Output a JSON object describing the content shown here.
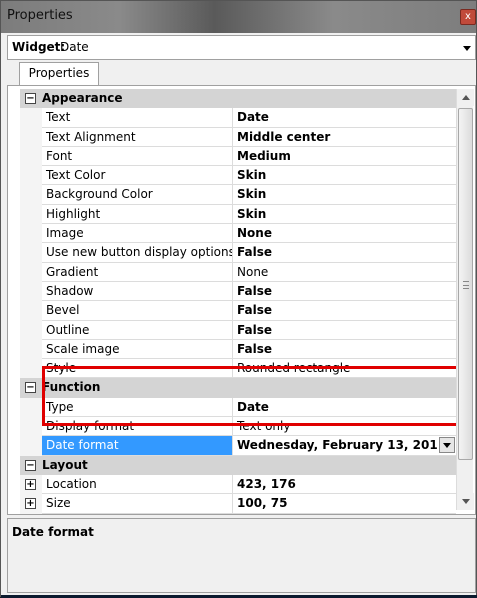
{
  "window": {
    "title": "Properties",
    "close_glyph": "x"
  },
  "widget": {
    "label": "Widget:",
    "value": "Date"
  },
  "tabs": [
    {
      "label": "Properties"
    }
  ],
  "categories": [
    {
      "label": "Appearance",
      "expander": "−",
      "rows": [
        {
          "name": "Text",
          "value": "Date",
          "bold": true
        },
        {
          "name": "Text Alignment",
          "value": "Middle center",
          "bold": true
        },
        {
          "name": "Font",
          "value": "Medium",
          "bold": true
        },
        {
          "name": "Text Color",
          "value": "Skin",
          "bold": true
        },
        {
          "name": "Background Color",
          "value": "Skin",
          "bold": true
        },
        {
          "name": "Highlight",
          "value": "Skin",
          "bold": true
        },
        {
          "name": "Image",
          "value": "None",
          "bold": true
        },
        {
          "name": "Use new button display options",
          "value": "False",
          "bold": true
        },
        {
          "name": "Gradient",
          "value": "None",
          "bold": false
        },
        {
          "name": "Shadow",
          "value": "False",
          "bold": true
        },
        {
          "name": "Bevel",
          "value": "False",
          "bold": true
        },
        {
          "name": "Outline",
          "value": "False",
          "bold": true
        },
        {
          "name": "Scale image",
          "value": "False",
          "bold": true
        },
        {
          "name": "Style",
          "value": "Rounded rectangle",
          "bold": false
        }
      ]
    },
    {
      "label": "Function",
      "expander": "−",
      "rows": [
        {
          "name": "Type",
          "value": "Date",
          "bold": true
        },
        {
          "name": "Display format",
          "value": "Text only",
          "bold": false
        },
        {
          "name": "Date format",
          "value": "Wednesday, February 13, 201",
          "bold": true,
          "selected": true
        }
      ]
    },
    {
      "label": "Layout",
      "expander": "−",
      "rows": [
        {
          "name": "Location",
          "value": "423, 176",
          "bold": true,
          "expandable": true,
          "expander": "+"
        },
        {
          "name": "Size",
          "value": "100, 75",
          "bold": true,
          "expandable": true,
          "expander": "+"
        }
      ]
    }
  ],
  "description": {
    "title": "Date format"
  },
  "colors": {
    "selection": "#3399ff",
    "highlight_box": "#e00000",
    "category_bg": "#d4d4d4"
  }
}
